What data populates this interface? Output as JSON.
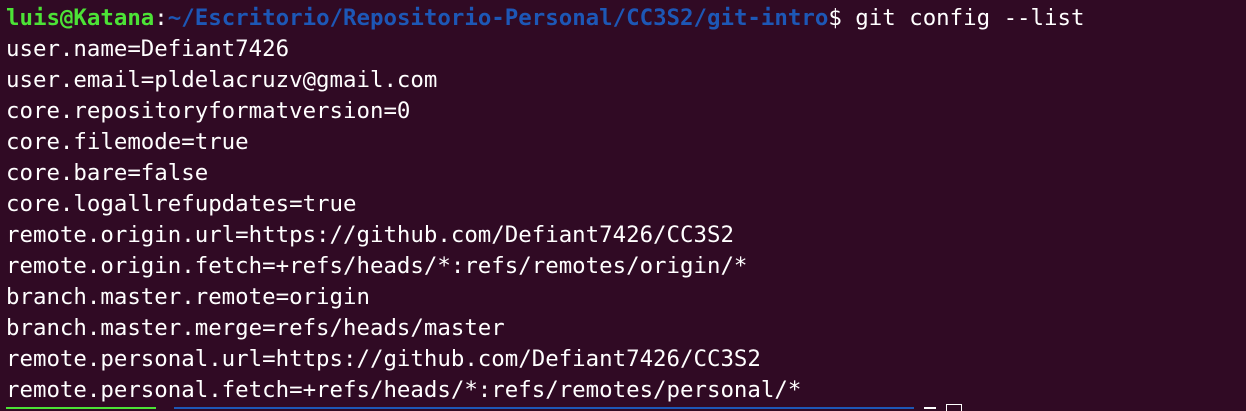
{
  "theme": {
    "background": "#300a24",
    "text": "#ffffff",
    "prompt_user_color": "#4ce236",
    "prompt_path_color": "#1d57b6"
  },
  "prompt": {
    "user_host": "luis@Katana",
    "separator": ":",
    "path": "~/Escritorio/Repositorio-Personal/CC3S2/git-intro",
    "symbol": "$",
    "command": " git config --list"
  },
  "output_lines": [
    "user.name=Defiant7426",
    "user.email=pldelacruzv@gmail.com",
    "core.repositoryformatversion=0",
    "core.filemode=true",
    "core.bare=false",
    "core.logallrefupdates=true",
    "remote.origin.url=https://github.com/Defiant7426/CC3S2",
    "remote.origin.fetch=+refs/heads/*:refs/remotes/origin/*",
    "branch.master.remote=origin",
    "branch.master.merge=refs/heads/master",
    "remote.personal.url=https://github.com/Defiant7426/CC3S2",
    "remote.personal.fetch=+refs/heads/*:refs/remotes/personal/*"
  ]
}
